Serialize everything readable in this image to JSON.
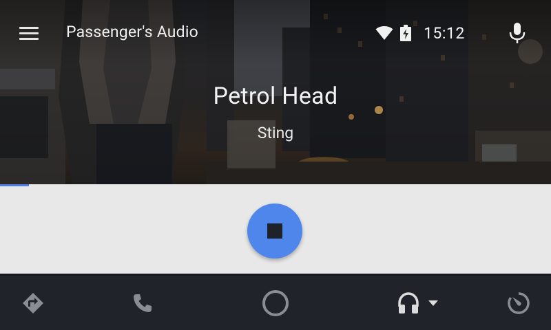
{
  "header": {
    "title": "Passenger's Audio",
    "time": "15:12",
    "menu_icon": "menu-icon",
    "mic_icon": "mic-icon",
    "status_icons": [
      "wifi-icon",
      "battery-charging-icon"
    ]
  },
  "now_playing": {
    "title": "Petrol Head",
    "artist": "Sting",
    "progress": 0.053
  },
  "controls": {
    "main_action": "stop-icon"
  },
  "nav": {
    "items": [
      {
        "name": "navigation",
        "icon": "directions-icon"
      },
      {
        "name": "phone",
        "icon": "phone-icon"
      },
      {
        "name": "home",
        "icon": "home-circle-icon"
      },
      {
        "name": "audio",
        "icon": "headphones-icon",
        "active": true
      },
      {
        "name": "overview",
        "icon": "dashboard-gauge-icon"
      }
    ]
  },
  "colors": {
    "accent": "#4f86ec",
    "panel": "#e8e8e8",
    "nav_bg": "#20242a"
  }
}
